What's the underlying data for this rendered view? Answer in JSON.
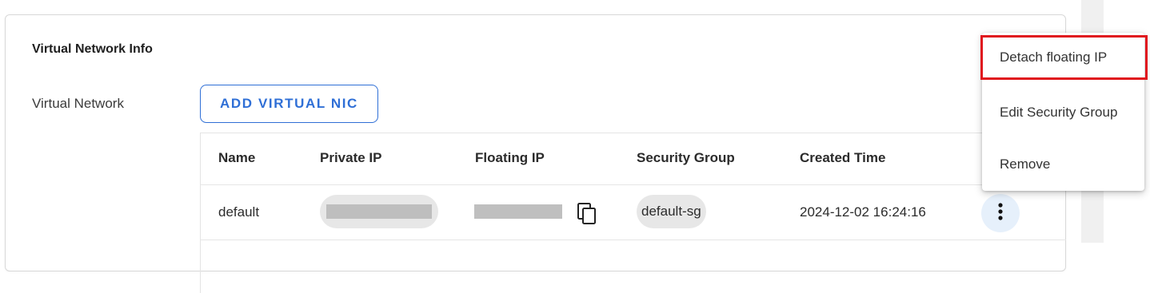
{
  "card": {
    "title": "Virtual Network Info",
    "field_label": "Virtual Network",
    "add_button_label": "ADD VIRTUAL NIC"
  },
  "table": {
    "columns": [
      "Name",
      "Private IP",
      "Floating IP",
      "Security Group",
      "Created Time"
    ],
    "rows": [
      {
        "name": "default",
        "security_group": "default-sg",
        "created_time": "2024-12-02 16:24:16"
      }
    ]
  },
  "menu": {
    "items": [
      "Detach floating IP",
      "Edit Security Group",
      "Remove"
    ],
    "highlighted_item": "Detach floating IP"
  },
  "colors": {
    "accent": "#2f6fd6",
    "highlight_border": "#e0161e",
    "chip_bg": "#e7e7e7",
    "kebab_bg": "#e6f0fb"
  },
  "icons": [
    "copy-icon",
    "more-vert-icon"
  ]
}
